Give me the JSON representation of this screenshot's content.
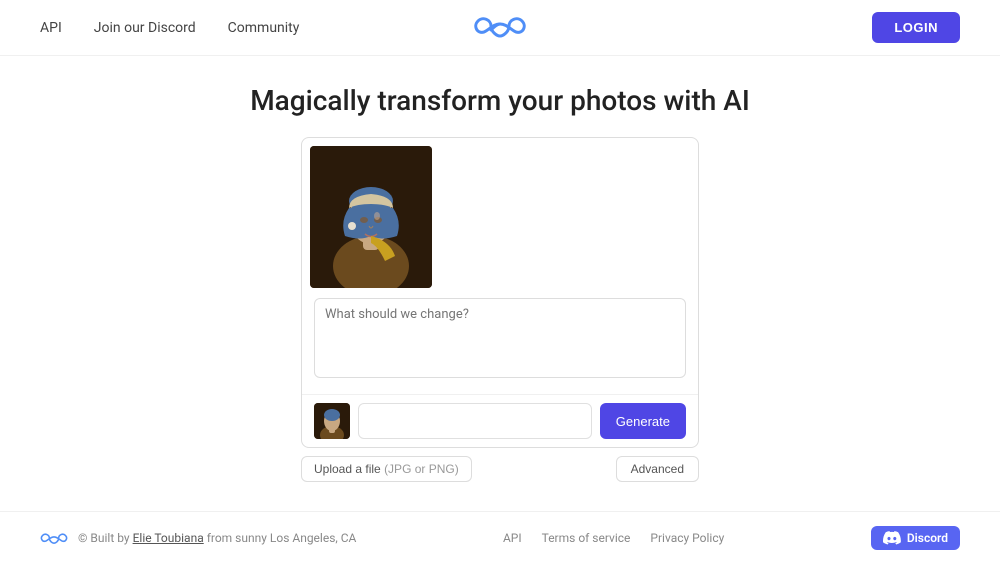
{
  "header": {
    "nav": [
      {
        "label": "API",
        "id": "api"
      },
      {
        "label": "Join our Discord",
        "id": "discord"
      },
      {
        "label": "Community",
        "id": "community"
      }
    ],
    "login_label": "LOGIN",
    "logo_alt": "Claid AI logo"
  },
  "hero": {
    "title": "Magically transform your photos with AI"
  },
  "card": {
    "prompt_placeholder": "What should we change?",
    "text_input_placeholder": "",
    "generate_label": "Generate",
    "upload_label": "Upload a file",
    "upload_hint": "(JPG or PNG)",
    "advanced_label": "Advanced"
  },
  "footer": {
    "copy": "© Built by",
    "author": "Elie Toubiana",
    "location": " from sunny Los Angeles, CA",
    "links": [
      {
        "label": "API"
      },
      {
        "label": "Terms of service"
      },
      {
        "label": "Privacy Policy"
      }
    ],
    "discord_label": "Discord"
  }
}
